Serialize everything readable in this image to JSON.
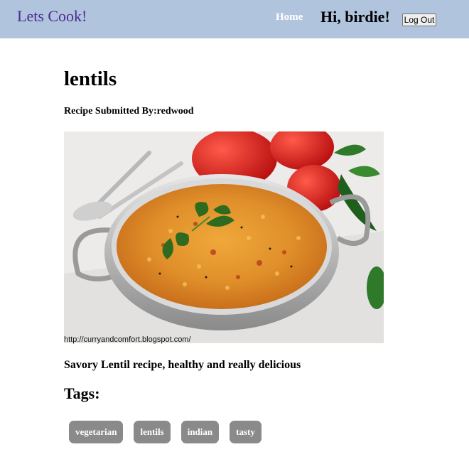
{
  "navbar": {
    "brand": "Lets Cook!",
    "home_link": "Home",
    "greeting": "Hi, birdie!",
    "logout_label": "Log Out"
  },
  "recipe": {
    "title": "lentils",
    "submitted_by": "Recipe Submitted By:redwood",
    "image_alt": "Bowl of lentil dal with tomatoes, spoons and parsley",
    "image_credit": "http://curryandcomfort.blogspot.com/",
    "description": "Savory Lentil recipe, healthy and really delicious",
    "tags_heading": "Tags:",
    "tags": [
      "vegetarian",
      "lentils",
      "indian",
      "tasty"
    ]
  },
  "colors": {
    "navbar_bg": "#b0c4de",
    "brand": "#4b2a8f",
    "tag_bg": "#8a8a8a"
  }
}
